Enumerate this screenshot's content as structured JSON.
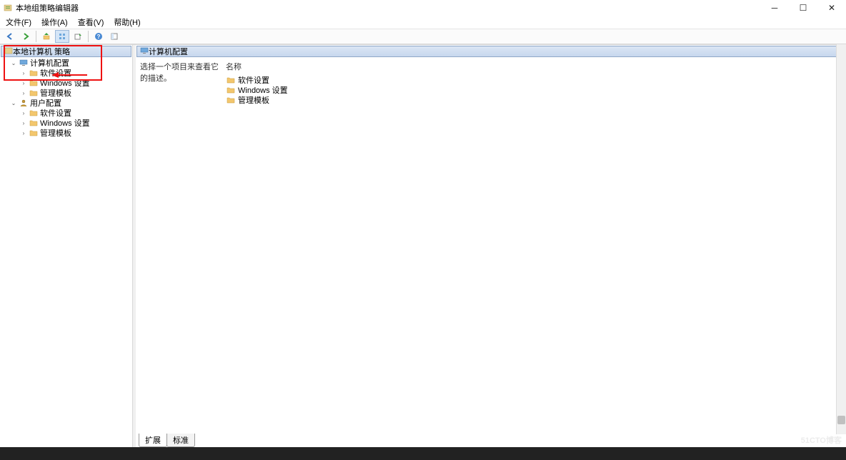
{
  "window": {
    "title": "本地组策略编辑器"
  },
  "menubar": {
    "file": "文件(F)",
    "action": "操作(A)",
    "view": "查看(V)",
    "help": "帮助(H)"
  },
  "toolbar": {
    "back": "←",
    "forward": "→",
    "up": "↑",
    "props": "▦",
    "refresh": "↻",
    "export": "▤",
    "help": "?"
  },
  "tree": {
    "root": "本地计算机 策略",
    "computer": {
      "label": "计算机配置",
      "children": {
        "software": "软件设置",
        "windows": "Windows 设置",
        "templates": "管理模板"
      }
    },
    "user": {
      "label": "用户配置",
      "children": {
        "software": "软件设置",
        "windows": "Windows 设置",
        "templates": "管理模板"
      }
    }
  },
  "main": {
    "header": "计算机配置",
    "description": "选择一个项目来查看它的描述。",
    "name_col": "名称",
    "items": {
      "software": "软件设置",
      "windows": "Windows 设置",
      "templates": "管理模板"
    },
    "tabs": {
      "extended": "扩展",
      "standard": "标准"
    }
  },
  "watermark": "51CTO博客"
}
